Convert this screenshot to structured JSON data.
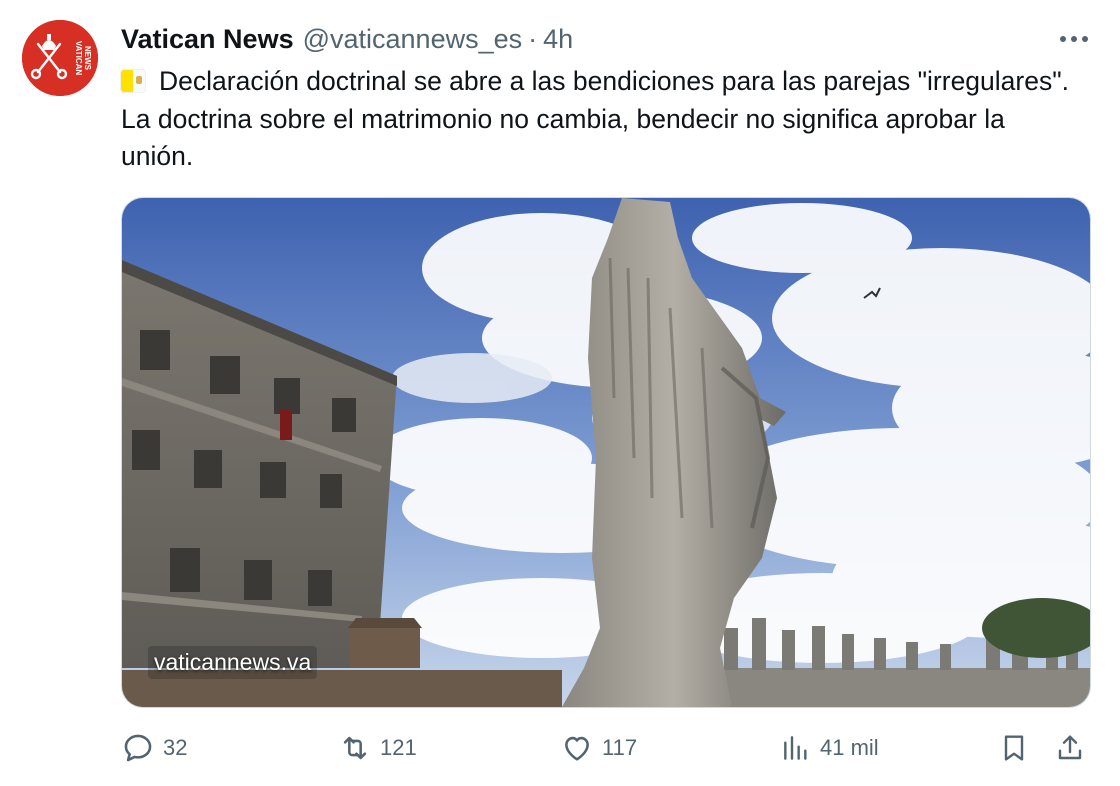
{
  "account": {
    "display_name": "Vatican News",
    "handle": "@vaticannews_es",
    "separator": "·",
    "time": "4h",
    "avatar_text_1": "VATICAN",
    "avatar_text_2": "NEWS"
  },
  "tweet": {
    "flag_icon": "vatican-flag-emoji",
    "text": "Declaración doctrinal se abre a las bendiciones para las parejas \"irregulares\". La doctrina sobre el matrimonio no cambia, bendecir no significa aprobar la unión."
  },
  "media": {
    "watermark": "vaticannews.va"
  },
  "actions": {
    "replies": "32",
    "retweets": "121",
    "likes": "117",
    "views": "41 mil"
  },
  "icons": {
    "more": "more-horizontal-icon",
    "reply": "reply-bubble-icon",
    "retweet": "retweet-icon",
    "like": "heart-icon",
    "views": "bar-chart-icon",
    "bookmark": "bookmark-icon",
    "share": "share-icon"
  },
  "colors": {
    "brand_red": "#d72f24",
    "secondary_text": "#536471",
    "primary_text": "#0f1419"
  }
}
